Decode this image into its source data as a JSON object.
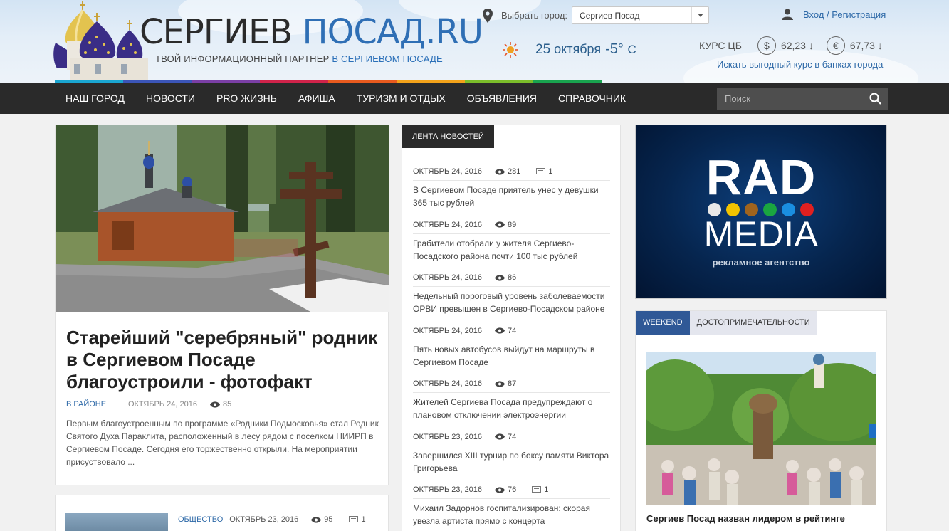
{
  "header": {
    "title_part1": "СЕРГИЕВ",
    "title_part2": "ПОСАД.RU",
    "tagline": "ТВОЙ ИНФОРМАЦИОННЫЙ ПАРТНЕР",
    "tagline_highlight": "В СЕРГИЕВОМ ПОСАДЕ",
    "city_label": "Выбрать город:",
    "city_selected": "Сергиев Посад",
    "login_label": "Вход / Регистрация",
    "weather": {
      "day": "25",
      "month": "октября",
      "temp": "-5°",
      "unit": "C",
      "icon": "sun-icon"
    },
    "rates": {
      "label": "КУРС ЦБ",
      "usd": {
        "symbol": "$",
        "value": "62,23 ↓"
      },
      "eur": {
        "symbol": "€",
        "value": "67,73 ↓"
      },
      "link": "Искать выгодный курс в банках города"
    },
    "rainbow_colors": [
      "#1aa6d1",
      "#3b55b8",
      "#7b3fa6",
      "#d0234a",
      "#e85a1e",
      "#f3a21a",
      "#7bbd2a",
      "#19a44f"
    ]
  },
  "nav": {
    "items": [
      "НАШ ГОРОД",
      "НОВОСТИ",
      "PRO ЖИЗНЬ",
      "АФИША",
      "ТУРИЗМ И ОТДЫХ",
      "ОБЪЯВЛЕНИЯ",
      "СПРАВОЧНИК"
    ],
    "search_placeholder": "Поиск"
  },
  "featured": {
    "title": "Старейший \"серебряный\" родник в Сергиевом Посаде благоустроили - фотофакт",
    "category": "В РАЙОНЕ",
    "separator": "|",
    "date": "ОКТЯБРЬ 24, 2016",
    "views": "85",
    "excerpt": "Первым благоустроенным по программе «Родники Подмосковья» стал Родник Святого Духа Параклита, расположенный в лесу рядом с поселком НИИРП в Сергиевом Посаде. Сегодня его торжественно открыли. На мероприятии присуствовало ..."
  },
  "second_article": {
    "category": "ОБЩЕСТВО",
    "date": "ОКТЯБРЬ 23, 2016",
    "views": "95",
    "comments": "1"
  },
  "feed": {
    "tab": "ЛЕНТА НОВОСТЕЙ",
    "items": [
      {
        "date": "ОКТЯБРЬ 24, 2016",
        "views": "281",
        "comments": "1",
        "title": "В Сергиевом Посаде приятель унес у девушки 365 тыс рублей"
      },
      {
        "date": "ОКТЯБРЬ 24, 2016",
        "views": "89",
        "comments": "",
        "title": "Грабители отобрали у жителя Сергиево-Посадского района почти 100 тыс рублей"
      },
      {
        "date": "ОКТЯБРЬ 24, 2016",
        "views": "86",
        "comments": "",
        "title": "Недельный пороговый уровень заболеваемости ОРВИ превышен в Сергиево-Посадском районе"
      },
      {
        "date": "ОКТЯБРЬ 24, 2016",
        "views": "74",
        "comments": "",
        "title": "Пять новых автобусов выйдут на маршруты в Сергиевом Посаде"
      },
      {
        "date": "ОКТЯБРЬ 24, 2016",
        "views": "87",
        "comments": "",
        "title": "Жителей Сергиева Посада предупреждают о плановом отключении электроэнергии"
      },
      {
        "date": "ОКТЯБРЬ 23, 2016",
        "views": "74",
        "comments": "",
        "title": "Завершился XIII турнир по боксу памяти Виктора Григорьева"
      },
      {
        "date": "ОКТЯБРЬ 23, 2016",
        "views": "76",
        "comments": "1",
        "title": "Михаил Задорнов госпитализирован: скорая увезла артиста прямо с концерта"
      }
    ]
  },
  "ad": {
    "line1": "RAD",
    "line2": "MEDIA",
    "subtitle": "рекламное агентство",
    "dot_colors": [
      "#e8e8e8",
      "#f2c400",
      "#a0641e",
      "#1aa640",
      "#1a8ee0",
      "#e02020"
    ]
  },
  "weekend": {
    "tabs": [
      "WEEKEND",
      "ДОСТОПРИМЕЧАТЕЛЬНОСТИ"
    ],
    "title": "Сергиев Посад назван лидером в рейтинге"
  }
}
